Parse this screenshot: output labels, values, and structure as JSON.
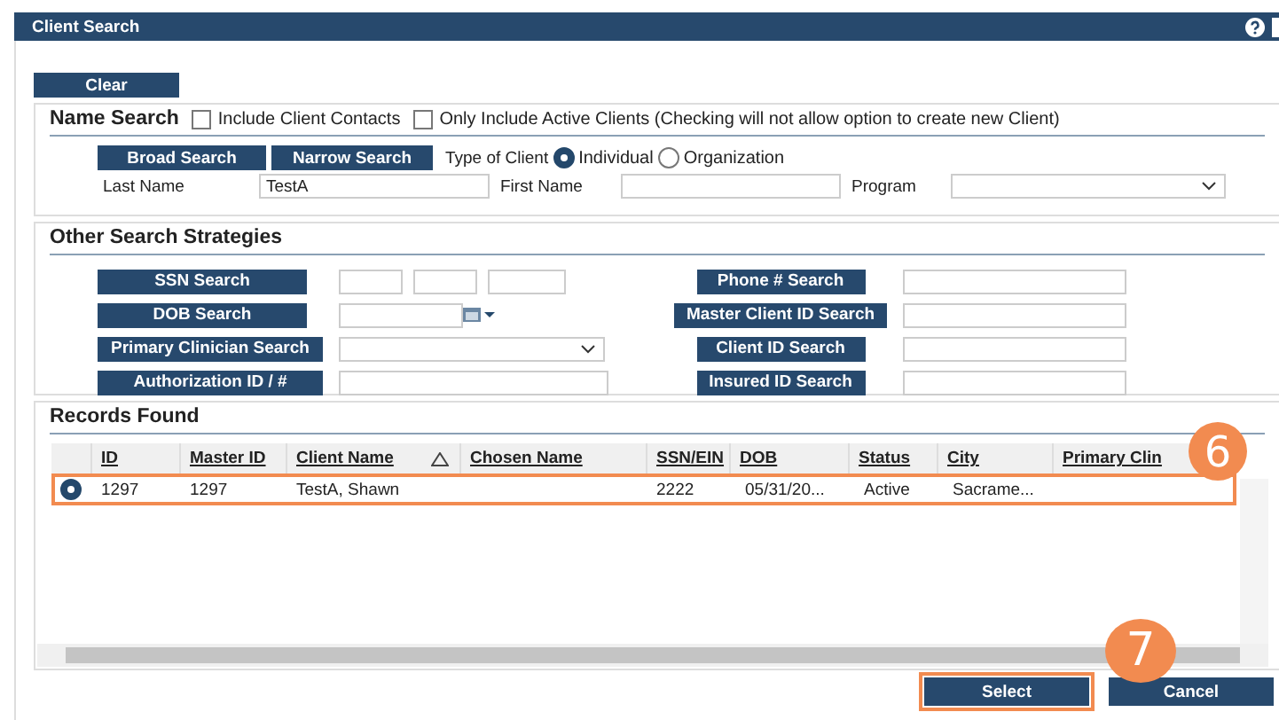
{
  "window": {
    "title": "Client Search"
  },
  "clear_button": "Clear",
  "name_search": {
    "title": "Name Search",
    "options": [
      {
        "label": "Include Client Contacts",
        "checked": false
      },
      {
        "label": "Only Include Active Clients (Checking will not allow option to create new Client)",
        "checked": false
      }
    ],
    "buttons": [
      "Broad Search",
      "Narrow Search"
    ],
    "type_label": "Type of Client",
    "client_types": [
      {
        "label": "Individual",
        "selected": true
      },
      {
        "label": "Organization",
        "selected": false
      }
    ],
    "fields": [
      {
        "label": "Last Name",
        "value": "TestA",
        "kind": "text"
      },
      {
        "label": "First Name",
        "kind": "text"
      },
      {
        "label": "Program",
        "kind": "select"
      }
    ]
  },
  "other_search": {
    "title": "Other Search Strategies",
    "left": [
      {
        "button": "SSN Search",
        "kind": "ssn"
      },
      {
        "button": "DOB Search",
        "kind": "date"
      },
      {
        "button": "Primary Clinician Search",
        "kind": "select"
      },
      {
        "button": "Authorization ID / #",
        "kind": "text"
      }
    ],
    "right": [
      {
        "button": "Phone # Search",
        "kind": "text"
      },
      {
        "button": "Master Client ID Search",
        "kind": "text"
      },
      {
        "button": "Client ID Search",
        "kind": "text"
      },
      {
        "button": "Insured ID Search",
        "kind": "text"
      }
    ]
  },
  "records": {
    "title": "Records Found",
    "columns": [
      {
        "label": "ID",
        "sorted": false
      },
      {
        "label": "Master ID",
        "sorted": false
      },
      {
        "label": "Client Name",
        "sorted": true
      },
      {
        "label": "Chosen Name",
        "sorted": false
      },
      {
        "label": "SSN/EIN",
        "sorted": false
      },
      {
        "label": "DOB",
        "sorted": false
      },
      {
        "label": "Status",
        "sorted": false
      },
      {
        "label": "City",
        "sorted": false
      },
      {
        "label": "Primary Clin",
        "sorted": false
      }
    ],
    "rows": [
      {
        "selected": true,
        "cells": [
          "1297",
          "1297",
          "TestA, Shawn",
          "",
          "2222",
          "05/31/20...",
          "Active",
          "Sacrame...",
          ""
        ]
      }
    ]
  },
  "footer_buttons": [
    {
      "label": "Select",
      "highlighted": true
    },
    {
      "label": "Cancel",
      "highlighted": false
    }
  ],
  "callouts": [
    {
      "number": "6"
    },
    {
      "number": "7"
    }
  ]
}
